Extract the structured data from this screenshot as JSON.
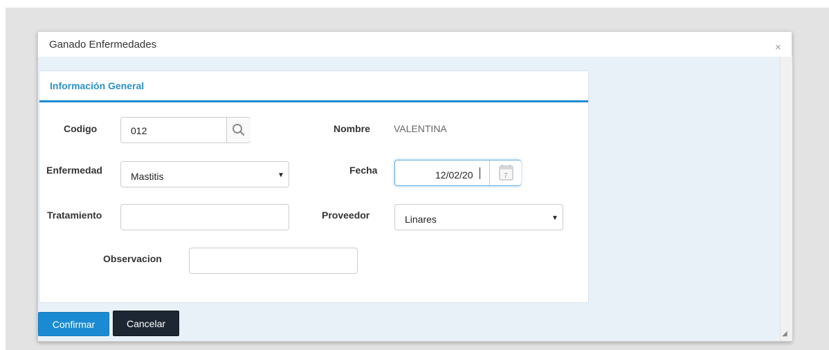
{
  "dialog": {
    "title": "Ganado Enfermedades",
    "close_glyph": "×",
    "panel_title": "Información General"
  },
  "form": {
    "codigo": {
      "label": "Codigo",
      "value": "012"
    },
    "nombre": {
      "label": "Nombre",
      "value": "VALENTINA"
    },
    "enfermedad": {
      "label": "Enfermedad",
      "value": "Mastitis"
    },
    "fecha": {
      "label": "Fecha",
      "value": "12/02/20",
      "calendar_day": "7"
    },
    "tratamiento": {
      "label": "Tratamiento",
      "value": ""
    },
    "proveedor": {
      "label": "Proveedor",
      "value": "Linares"
    },
    "observacion": {
      "label": "Observacion",
      "value": ""
    }
  },
  "buttons": {
    "confirm": "Confirmar",
    "cancel": "Cancelar"
  },
  "icons": {
    "caret": "▼",
    "search": "search-icon",
    "calendar": "calendar-icon",
    "resize": "◢"
  },
  "colors": {
    "accent": "#2d8fce",
    "panel_rule": "#1b8ad0",
    "confirm_bg": "#1a8bd2",
    "cancel_bg": "#1d2733"
  }
}
